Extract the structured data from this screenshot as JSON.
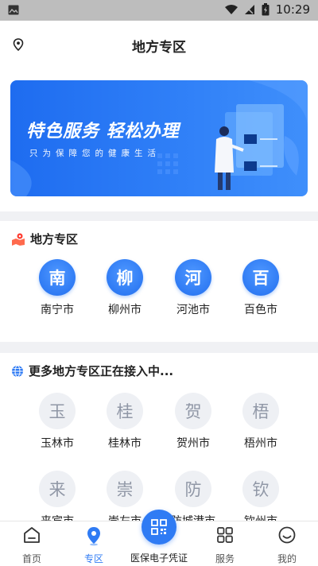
{
  "status_bar": {
    "time": "10:29"
  },
  "header": {
    "title": "地方专区",
    "location_icon": "location-pin-icon"
  },
  "banner": {
    "headline": "特色服务 轻松办理",
    "subline": "只为保障您的健康生活"
  },
  "local_zone": {
    "title": "地方专区",
    "cities": [
      {
        "char": "南",
        "name": "南宁市"
      },
      {
        "char": "柳",
        "name": "柳州市"
      },
      {
        "char": "河",
        "name": "河池市"
      },
      {
        "char": "百",
        "name": "百色市"
      }
    ]
  },
  "more_zone": {
    "title": "更多地方专区正在接入中...",
    "cities": [
      {
        "char": "玉",
        "name": "玉林市"
      },
      {
        "char": "桂",
        "name": "桂林市"
      },
      {
        "char": "贺",
        "name": "贺州市"
      },
      {
        "char": "梧",
        "name": "梧州市"
      },
      {
        "char": "来",
        "name": "来宾市"
      },
      {
        "char": "崇",
        "name": "崇左市"
      },
      {
        "char": "防",
        "name": "防城港市"
      },
      {
        "char": "钦",
        "name": "钦州市"
      }
    ]
  },
  "tabbar": {
    "home": "首页",
    "zone": "专区",
    "voucher": "医保电子凭证",
    "service": "服务",
    "mine": "我的"
  },
  "colors": {
    "accent": "#2f7bf4",
    "banner_start": "#1e6cf0"
  }
}
